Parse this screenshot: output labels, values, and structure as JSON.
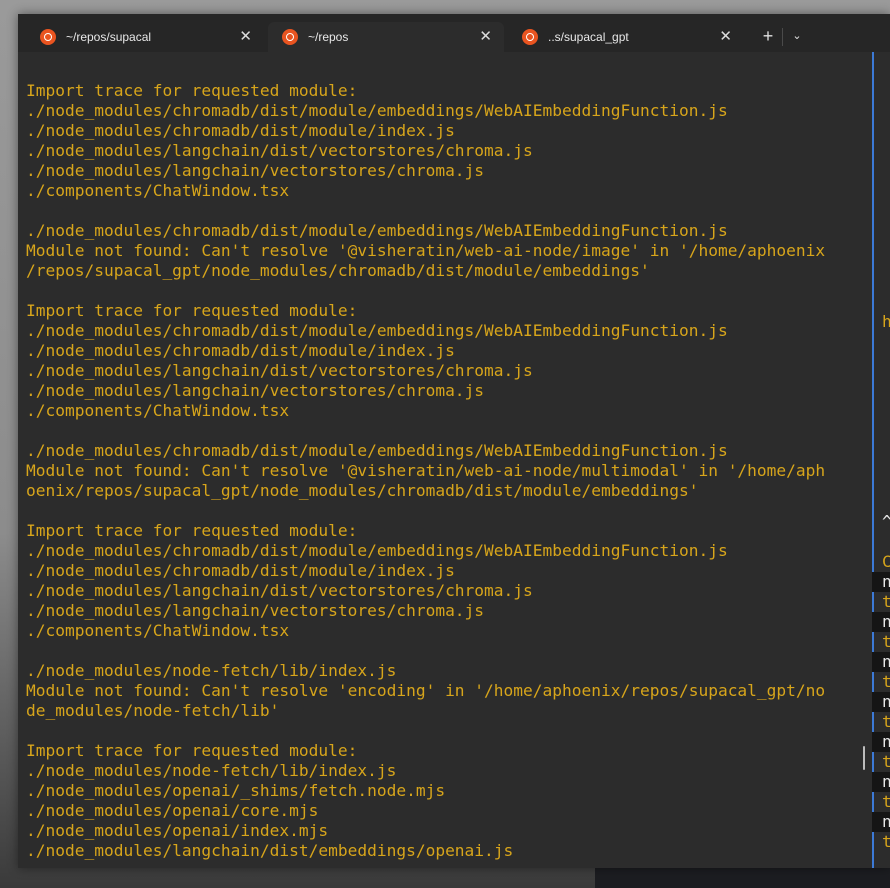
{
  "tabs": [
    {
      "label": "~/repos/supacal",
      "close": "✕",
      "active": false
    },
    {
      "label": "~/repos",
      "close": "✕",
      "active": true
    },
    {
      "label": "..s/supacal_gpt",
      "close": "✕",
      "active": false
    }
  ],
  "tab_controls": {
    "new_tab": "+",
    "dropdown": "⌄"
  },
  "terminal": {
    "text_color": "#d7a51b",
    "lines": [
      "Import trace for requested module:",
      "./node_modules/chromadb/dist/module/embeddings/WebAIEmbeddingFunction.js",
      "./node_modules/chromadb/dist/module/index.js",
      "./node_modules/langchain/dist/vectorstores/chroma.js",
      "./node_modules/langchain/vectorstores/chroma.js",
      "./components/ChatWindow.tsx",
      "",
      "./node_modules/chromadb/dist/module/embeddings/WebAIEmbeddingFunction.js",
      "Module not found: Can't resolve '@visheratin/web-ai-node/image' in '/home/aphoenix",
      "/repos/supacal_gpt/node_modules/chromadb/dist/module/embeddings'",
      "",
      "Import trace for requested module:",
      "./node_modules/chromadb/dist/module/embeddings/WebAIEmbeddingFunction.js",
      "./node_modules/chromadb/dist/module/index.js",
      "./node_modules/langchain/dist/vectorstores/chroma.js",
      "./node_modules/langchain/vectorstores/chroma.js",
      "./components/ChatWindow.tsx",
      "",
      "./node_modules/chromadb/dist/module/embeddings/WebAIEmbeddingFunction.js",
      "Module not found: Can't resolve '@visheratin/web-ai-node/multimodal' in '/home/aph",
      "oenix/repos/supacal_gpt/node_modules/chromadb/dist/module/embeddings'",
      "",
      "Import trace for requested module:",
      "./node_modules/chromadb/dist/module/embeddings/WebAIEmbeddingFunction.js",
      "./node_modules/chromadb/dist/module/index.js",
      "./node_modules/langchain/dist/vectorstores/chroma.js",
      "./node_modules/langchain/vectorstores/chroma.js",
      "./components/ChatWindow.tsx",
      "",
      "./node_modules/node-fetch/lib/index.js",
      "Module not found: Can't resolve 'encoding' in '/home/aphoenix/repos/supacal_gpt/no",
      "de_modules/node-fetch/lib'",
      "",
      "Import trace for requested module:",
      "./node_modules/node-fetch/lib/index.js",
      "./node_modules/openai/_shims/fetch.node.mjs",
      "./node_modules/openai/core.mjs",
      "./node_modules/openai/index.mjs",
      "./node_modules/langchain/dist/embeddings/openai.js"
    ]
  },
  "right_pane": {
    "lines": [
      {
        "text": "",
        "color": "white",
        "hl": false
      },
      {
        "text": "",
        "color": "white",
        "hl": false
      },
      {
        "text": "",
        "color": "white",
        "hl": false
      },
      {
        "text": "",
        "color": "white",
        "hl": false
      },
      {
        "text": "",
        "color": "white",
        "hl": false
      },
      {
        "text": "",
        "color": "white",
        "hl": false
      },
      {
        "text": "",
        "color": "white",
        "hl": false
      },
      {
        "text": "",
        "color": "white",
        "hl": false
      },
      {
        "text": "",
        "color": "white",
        "hl": false
      },
      {
        "text": "",
        "color": "white",
        "hl": false
      },
      {
        "text": "",
        "color": "white",
        "hl": false
      },
      {
        "text": "",
        "color": "white",
        "hl": false
      },
      {
        "text": "",
        "color": "white",
        "hl": false
      },
      {
        "text": "h",
        "color": "yellow",
        "hl": false
      },
      {
        "text": "",
        "color": "white",
        "hl": false
      },
      {
        "text": "",
        "color": "white",
        "hl": false
      },
      {
        "text": "",
        "color": "white",
        "hl": false
      },
      {
        "text": "",
        "color": "white",
        "hl": false
      },
      {
        "text": "",
        "color": "white",
        "hl": false
      },
      {
        "text": "",
        "color": "white",
        "hl": false
      },
      {
        "text": "",
        "color": "white",
        "hl": false
      },
      {
        "text": "",
        "color": "white",
        "hl": false
      },
      {
        "text": "",
        "color": "white",
        "hl": false
      },
      {
        "text": "^",
        "color": "white",
        "hl": false
      },
      {
        "text": "",
        "color": "white",
        "hl": false
      },
      {
        "text": "C",
        "color": "yellow",
        "hl": false
      },
      {
        "text": "n",
        "color": "white",
        "hl": true
      },
      {
        "text": "t",
        "color": "yellow",
        "hl": false
      },
      {
        "text": "n",
        "color": "white",
        "hl": true
      },
      {
        "text": "t",
        "color": "yellow",
        "hl": false
      },
      {
        "text": "n",
        "color": "white",
        "hl": true
      },
      {
        "text": "t",
        "color": "yellow",
        "hl": false
      },
      {
        "text": "n",
        "color": "white",
        "hl": true
      },
      {
        "text": "t",
        "color": "yellow",
        "hl": false
      },
      {
        "text": "n",
        "color": "white",
        "hl": true
      },
      {
        "text": "t",
        "color": "yellow",
        "hl": false
      },
      {
        "text": "n",
        "color": "white",
        "hl": true
      },
      {
        "text": "t",
        "color": "yellow",
        "hl": false
      },
      {
        "text": "n",
        "color": "white",
        "hl": true
      },
      {
        "text": "t",
        "color": "yellow",
        "hl": false
      }
    ]
  }
}
